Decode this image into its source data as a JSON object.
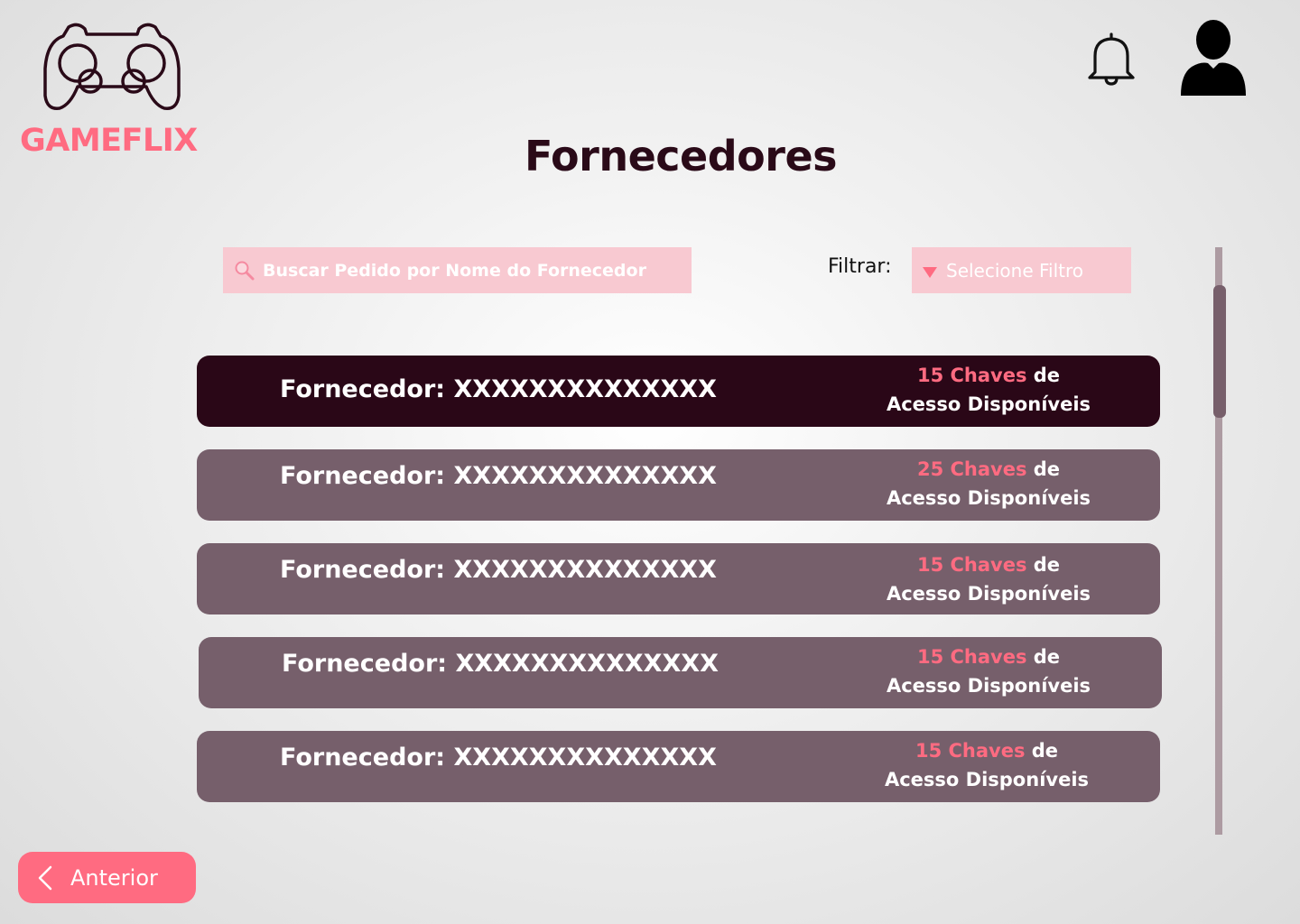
{
  "brand": {
    "name": "GAMEFLIX",
    "icon": "gamepad-icon",
    "color": "#ff6b81"
  },
  "header": {
    "notification_icon": "bell-icon",
    "profile_icon": "user-icon"
  },
  "page_title": "Fornecedores",
  "search": {
    "placeholder": "Buscar Pedido por Nome do Fornecedor",
    "icon": "search-icon"
  },
  "filter": {
    "label": "Filtrar:",
    "placeholder": "Selecione Filtro"
  },
  "suppliers": [
    {
      "name": "Fornecedor: XXXXXXXXXXXXXX",
      "count_text": "15 Chaves",
      "suffix": " de",
      "line2": "Acesso Disponíveis",
      "selected": true
    },
    {
      "name": "Fornecedor: XXXXXXXXXXXXXX",
      "count_text": "25 Chaves",
      "suffix": " de",
      "line2": "Acesso Disponíveis",
      "selected": false
    },
    {
      "name": "Fornecedor: XXXXXXXXXXXXXX",
      "count_text": "15 Chaves",
      "suffix": " de",
      "line2": "Acesso Disponíveis",
      "selected": false
    },
    {
      "name": "Fornecedor: XXXXXXXXXXXXXX",
      "count_text": "15 Chaves",
      "suffix": " de",
      "line2": "Acesso Disponíveis",
      "selected": false
    },
    {
      "name": "Fornecedor: XXXXXXXXXXXXXX",
      "count_text": "15 Chaves",
      "suffix": " de",
      "line2": "Acesso Disponíveis",
      "selected": false
    }
  ],
  "pagination": {
    "previous_label": "Anterior"
  },
  "colors": {
    "accent": "#ff6b81",
    "row": "#765f6b",
    "row_selected": "#2a0717",
    "input_bg": "#f8c9d1"
  }
}
